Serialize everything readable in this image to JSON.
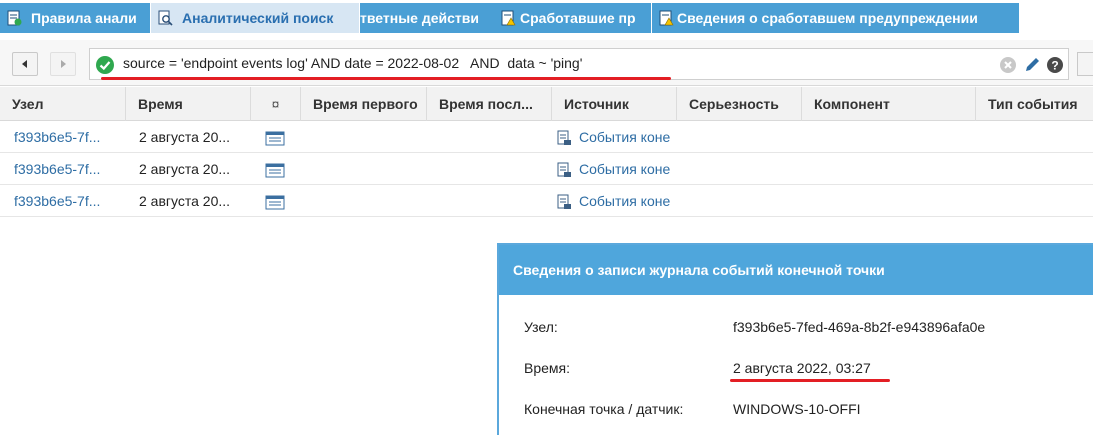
{
  "tabs": [
    {
      "label": "Правила анали",
      "active": false,
      "icon": "rules-doc-icon"
    },
    {
      "label": "Аналитический поиск",
      "active": true,
      "icon": "analytic-search-icon"
    },
    {
      "label": "тветные действи",
      "active": false,
      "icon": "response-doc-icon"
    },
    {
      "label": "Сработавшие пр",
      "active": false,
      "icon": "triggered-doc-icon"
    },
    {
      "label": "Сведения о сработавшем предупреждении",
      "active": false,
      "icon": "alert-details-doc-icon"
    }
  ],
  "filter": {
    "query": "source = 'endpoint events log' AND date = 2022-08-02   AND  data ~ 'ping'",
    "status_icon": "check-circle-icon",
    "clear_icon": "clear-icon",
    "edit_icon": "pencil-icon",
    "help_icon": "help-icon"
  },
  "columns": [
    "Узел",
    "Время",
    "¤",
    "Время первого",
    "Время посл...",
    "Источник",
    "Серьезность",
    "Компонент",
    "Тип события"
  ],
  "rows": [
    {
      "node": "f393b6e5-7f...",
      "time": "2 августа 20...",
      "source": "События коне"
    },
    {
      "node": "f393b6e5-7f...",
      "time": "2 августа 20...",
      "source": "События коне"
    },
    {
      "node": "f393b6e5-7f...",
      "time": "2 августа 20...",
      "source": "События коне"
    }
  ],
  "details": {
    "title": "Сведения о записи журнала событий конечной точки",
    "fields": [
      {
        "label": "Узел:",
        "value": "f393b6e5-7fed-469a-8b2f-e943896afa0e"
      },
      {
        "label": "Время:",
        "value": "2 августа 2022, 03:27"
      },
      {
        "label": "Конечная точка / датчик:",
        "value": "WINDOWS-10-OFFI"
      }
    ]
  },
  "colors": {
    "tab_bg": "#4a9fd5",
    "tab_active_bg": "#d7e6f3",
    "link": "#2e6da4",
    "panel_header": "#4fa6dc",
    "highlight": "#e31e24",
    "ok": "#2fa84f"
  }
}
